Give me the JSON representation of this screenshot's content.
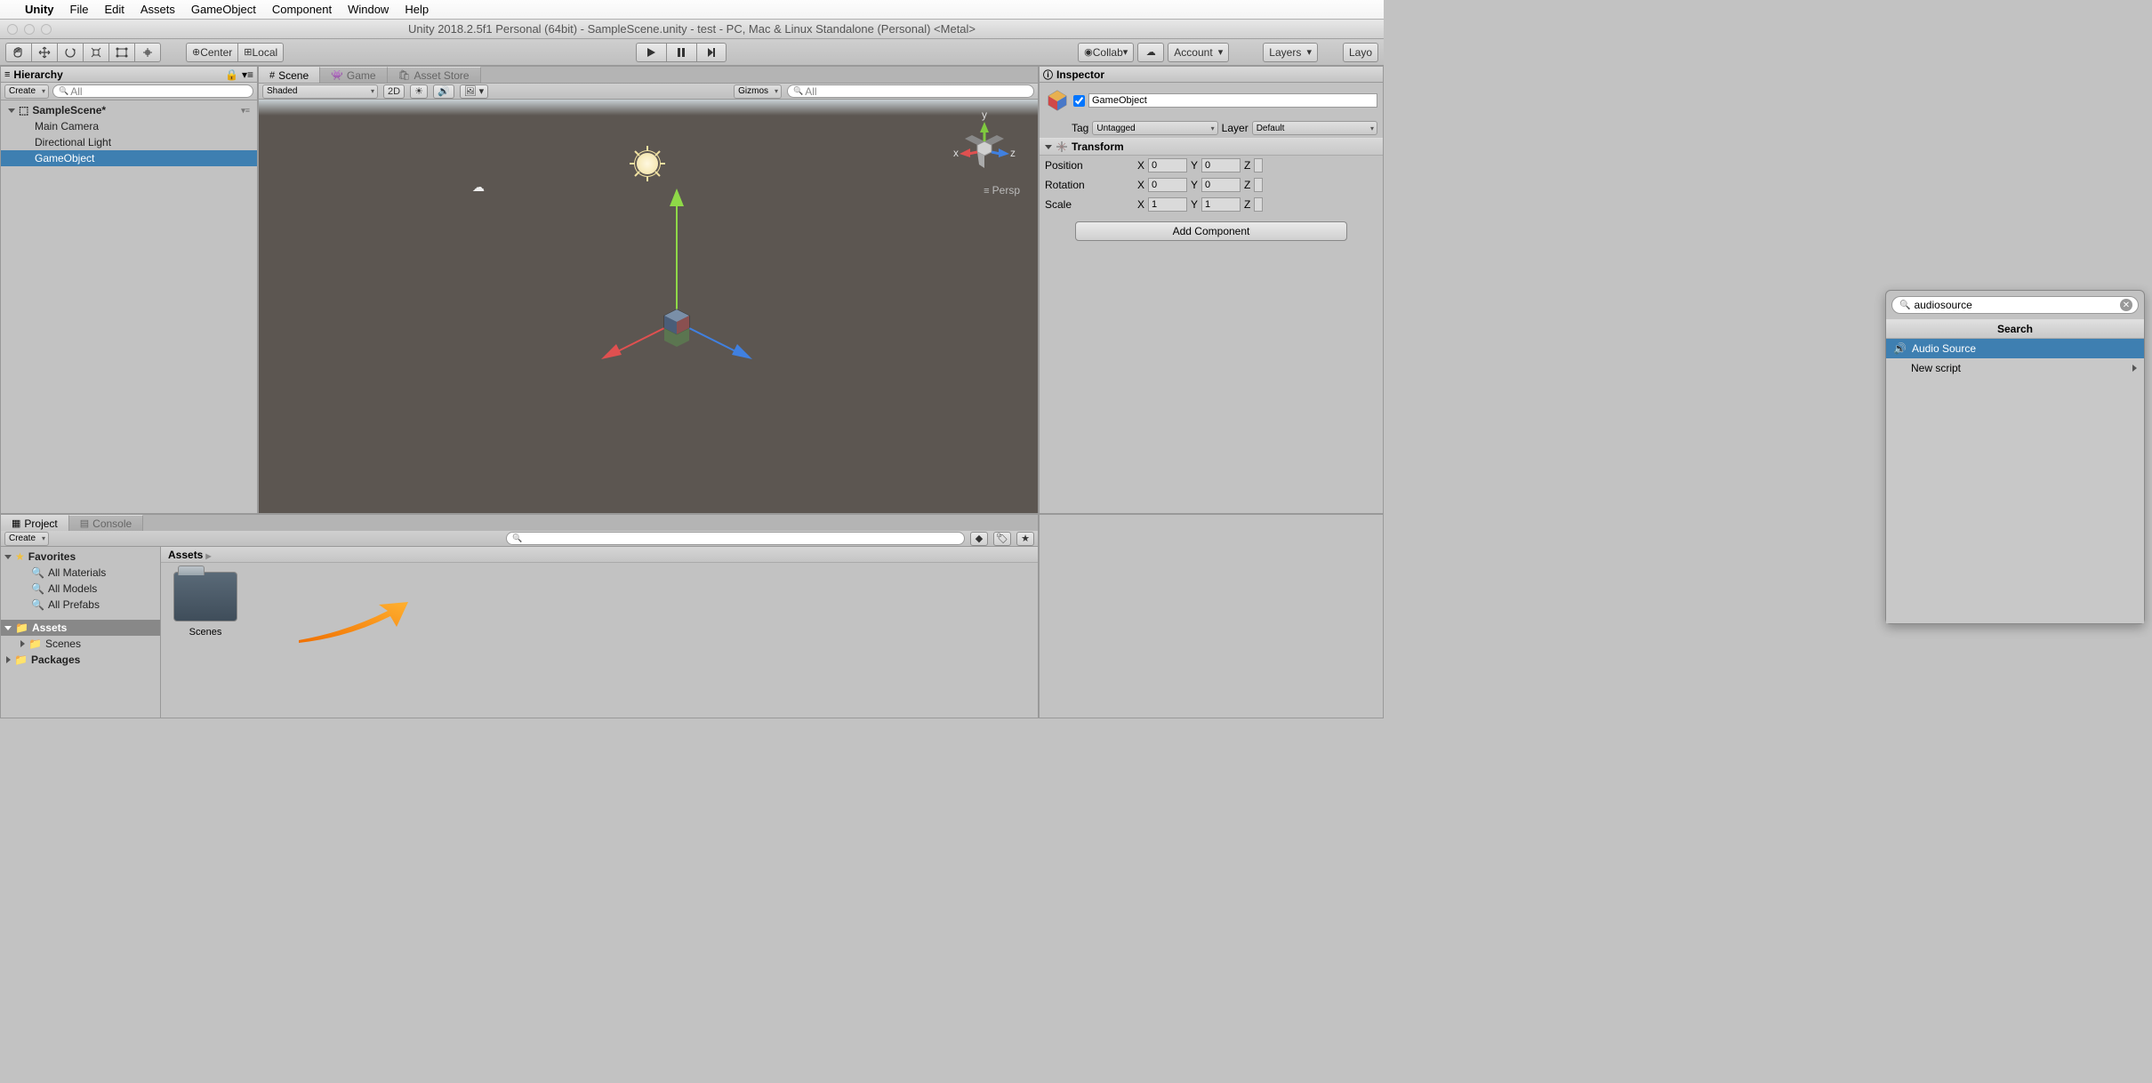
{
  "menubar": {
    "app": "Unity",
    "items": [
      "File",
      "Edit",
      "Assets",
      "GameObject",
      "Component",
      "Window",
      "Help"
    ]
  },
  "window_title": "Unity 2018.2.5f1 Personal (64bit) - SampleScene.unity - test - PC, Mac & Linux Standalone (Personal) <Metal>",
  "toolbar": {
    "pivot": "Center",
    "handle": "Local",
    "collab": "Collab",
    "account": "Account",
    "layers": "Layers",
    "layout": "Layo"
  },
  "hierarchy": {
    "title": "Hierarchy",
    "create": "Create",
    "search_placeholder": "All",
    "scene": "SampleScene*",
    "items": [
      "Main Camera",
      "Directional Light",
      "GameObject"
    ],
    "selected_index": 2
  },
  "scene_tabs": {
    "scene": "Scene",
    "game": "Game",
    "asset_store": "Asset Store"
  },
  "scene_bar": {
    "shading": "Shaded",
    "two_d": "2D",
    "gizmos": "Gizmos",
    "search_placeholder": "All"
  },
  "persp_label": "Persp",
  "axis_labels": {
    "x": "x",
    "y": "y",
    "z": "z"
  },
  "inspector": {
    "title": "Inspector",
    "name": "GameObject",
    "tag_label": "Tag",
    "tag": "Untagged",
    "layer_label": "Layer",
    "layer": "Default",
    "transform": {
      "title": "Transform",
      "position": {
        "label": "Position",
        "x": "0",
        "y": "0",
        "z": ""
      },
      "rotation": {
        "label": "Rotation",
        "x": "0",
        "y": "0",
        "z": ""
      },
      "scale": {
        "label": "Scale",
        "x": "1",
        "y": "1",
        "z": ""
      }
    },
    "xl": "X",
    "yl": "Y",
    "zl": "Z",
    "add_component": "Add Component"
  },
  "popup": {
    "search_value": "audiosource",
    "header": "Search",
    "items": [
      {
        "label": "Audio Source",
        "icon": "audio",
        "selected": true
      },
      {
        "label": "New script",
        "icon": "",
        "selected": false
      }
    ]
  },
  "project": {
    "tabs": {
      "project": "Project",
      "console": "Console"
    },
    "create": "Create",
    "favorites": "Favorites",
    "fav_items": [
      "All Materials",
      "All Models",
      "All Prefabs"
    ],
    "assets": "Assets",
    "tree_items": [
      "Scenes",
      "Packages"
    ],
    "breadcrumb": "Assets",
    "folder": "Scenes"
  }
}
